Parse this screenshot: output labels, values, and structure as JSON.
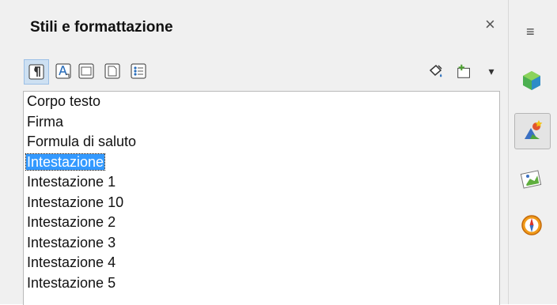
{
  "panel": {
    "title": "Stili e formattazione",
    "close_label": "×",
    "toolbar": [
      {
        "icon": "paragraph-styles-icon"
      },
      {
        "icon": "character-styles-icon"
      },
      {
        "icon": "frame-styles-icon"
      },
      {
        "icon": "page-styles-icon"
      },
      {
        "icon": "list-styles-icon"
      }
    ],
    "actions": [
      {
        "icon": "fill-format-mode-icon"
      },
      {
        "icon": "new-style-from-selection-icon"
      },
      {
        "icon": "dropdown-arrow-icon",
        "label": "▾"
      }
    ],
    "styles": [
      {
        "label": "Corpo testo"
      },
      {
        "label": "Firma"
      },
      {
        "label": "Formula di saluto"
      },
      {
        "label": "Intestazione",
        "selected": true
      },
      {
        "label": "Intestazione 1"
      },
      {
        "label": "Intestazione 10"
      },
      {
        "label": "Intestazione 2"
      },
      {
        "label": "Intestazione 3"
      },
      {
        "label": "Intestazione 4"
      },
      {
        "label": "Intestazione 5"
      }
    ]
  },
  "sidebar_deck": {
    "menu_label": "≡",
    "buttons": [
      {
        "icon": "properties-icon"
      },
      {
        "icon": "styles-and-formatting-icon",
        "active": true
      },
      {
        "icon": "gallery-icon"
      },
      {
        "icon": "navigator-icon"
      }
    ]
  },
  "colors": {
    "selection": "#3399ff",
    "panel_bg": "#f0f0f0",
    "active_btn": "#cde0f2"
  }
}
